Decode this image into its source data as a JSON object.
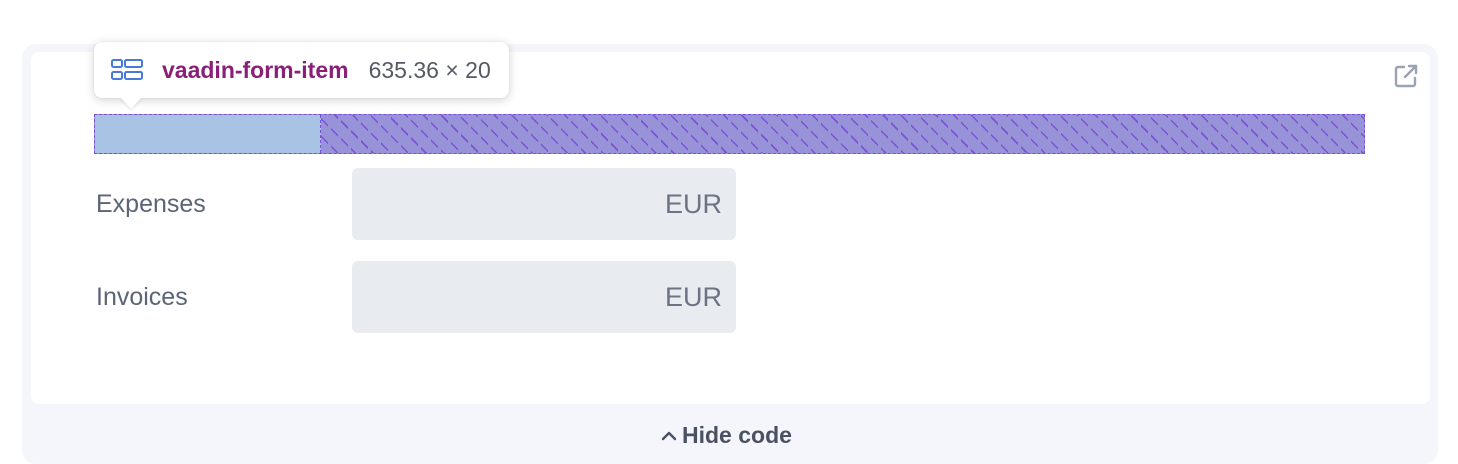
{
  "tooltip": {
    "element_name": "vaadin-form-item",
    "size": "635.36 × 20",
    "icon": "form-layout-icon"
  },
  "toolbar": {
    "open_external_icon": "external-link-icon"
  },
  "form": {
    "rows": [
      {
        "label": "Expenses",
        "value": "",
        "suffix": "EUR"
      },
      {
        "label": "Invoices",
        "value": "",
        "suffix": "EUR"
      }
    ]
  },
  "footer": {
    "hide_code_label": "Hide code",
    "hide_code_icon": "chevron-up-icon"
  },
  "colors": {
    "element_name": "#8a1f78",
    "highlight_content": "#9892d9",
    "highlight_label": "#a8c3e4",
    "highlight_border": "#7c4ddb",
    "input_background": "#e8ebef"
  }
}
